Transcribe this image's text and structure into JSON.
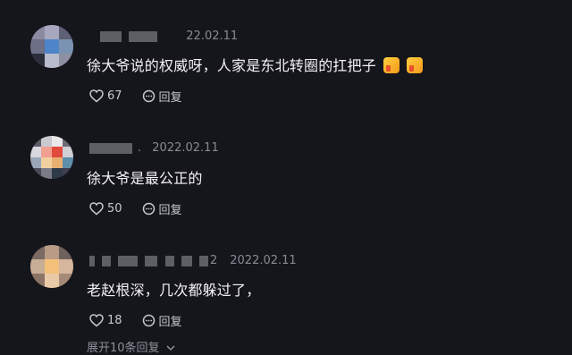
{
  "comments": [
    {
      "date": "22.02.11",
      "text": "徐大爷说的权威呀，人家是东北转圈的扛把子",
      "like_icon": "heart-outline",
      "likes": "67",
      "reply_icon": "reply-bubble",
      "reply_label": "回复",
      "emojis": [
        "thumbs-up",
        "thumbs-up"
      ]
    },
    {
      "date": "2022.02.11",
      "text": "徐大爷是最公正的",
      "like_icon": "heart-outline",
      "likes": "50",
      "reply_icon": "reply-bubble",
      "reply_label": "回复"
    },
    {
      "date": "2022.02.11",
      "name_tail": "2",
      "text": "老赵根深，几次都躲过了，",
      "like_icon": "heart-outline",
      "likes": "18",
      "reply_icon": "reply-bubble",
      "reply_label": "回复"
    }
  ],
  "expand_label": "展开10条回复",
  "expand_icon": "chevron-down",
  "colors": {
    "background": "#15151c",
    "text": "#f2f2f6",
    "muted": "#8a8a94"
  }
}
